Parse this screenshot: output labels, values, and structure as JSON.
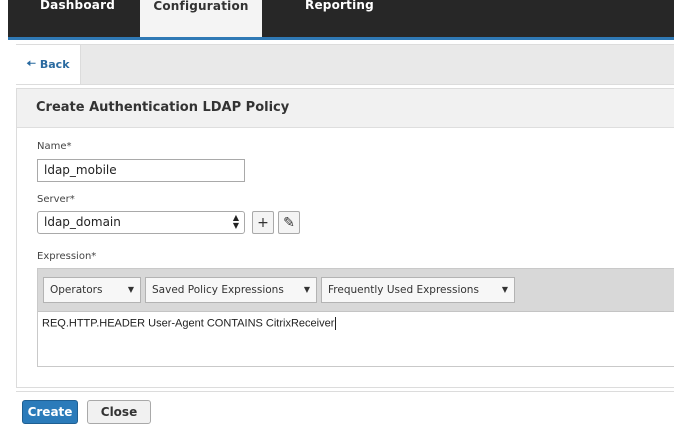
{
  "nav": {
    "tabs": [
      {
        "label": "Dashboard"
      },
      {
        "label": "Configuration"
      },
      {
        "label": "Reporting"
      }
    ],
    "active_tab": "Configuration"
  },
  "back_label": "Back",
  "panel": {
    "title": "Create Authentication LDAP Policy",
    "name_label": "Name*",
    "name_value": "ldap_mobile",
    "server_label": "Server*",
    "server_value": "ldap_domain",
    "expression_label": "Expression*",
    "expression_dropdowns": [
      {
        "label": "Operators"
      },
      {
        "label": "Saved Policy Expressions"
      },
      {
        "label": "Frequently Used Expressions"
      }
    ],
    "expression_value": "REQ.HTTP.HEADER User-Agent CONTAINS CitrixReceiver"
  },
  "footer": {
    "create_label": "Create",
    "close_label": "Close"
  },
  "colors": {
    "primary_button": "#2b7bba",
    "topbar": "#272727"
  }
}
